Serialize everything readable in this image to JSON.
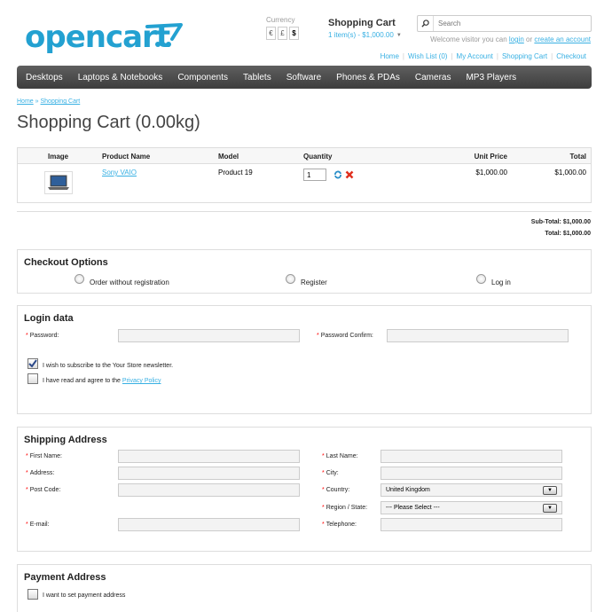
{
  "header": {
    "logo_text": "opencart",
    "currency_label": "Currency",
    "currencies": [
      "€",
      "£",
      "$"
    ],
    "cart_title": "Shopping Cart",
    "cart_summary": "1 item(s) - $1,000.00",
    "search_placeholder": "Search",
    "welcome_prefix": "Welcome visitor you can",
    "welcome_login": "login",
    "welcome_or": "or",
    "welcome_create": "create an account",
    "top_links": [
      "Home",
      "Wish List (0)",
      "My Account",
      "Shopping Cart",
      "Checkout"
    ]
  },
  "menu": [
    "Desktops",
    "Laptops & Notebooks",
    "Components",
    "Tablets",
    "Software",
    "Phones & PDAs",
    "Cameras",
    "MP3 Players"
  ],
  "breadcrumb": {
    "home": "Home",
    "sep": "»",
    "current": "Shopping Cart"
  },
  "page_title": "Shopping Cart  (0.00kg)",
  "cart_table": {
    "headers": {
      "image": "Image",
      "name": "Product Name",
      "model": "Model",
      "quantity": "Quantity",
      "unit_price": "Unit Price",
      "total": "Total"
    },
    "row": {
      "name": "Sony VAIO",
      "model": "Product 19",
      "quantity": "1",
      "unit_price": "$1,000.00",
      "total": "$1,000.00"
    }
  },
  "totals": {
    "subtotal_label": "Sub-Total:",
    "subtotal_value": "$1,000.00",
    "total_label": "Total:",
    "total_value": "$1,000.00"
  },
  "checkout_options": {
    "title": "Checkout Options",
    "options": [
      "Order without registration",
      "Register",
      "Log in"
    ]
  },
  "login_data": {
    "title": "Login data",
    "password_label": "Password:",
    "password_confirm_label": "Password Confirm:",
    "newsletter_label": "I wish to subscribe to the Your Store newsletter.",
    "privacy_prefix": "I have read and agree to the",
    "privacy_link": "Privacy Policy"
  },
  "shipping": {
    "title": "Shipping Address",
    "first_name": "First Name:",
    "last_name": "Last Name:",
    "address": "Address:",
    "city": "City:",
    "post_code": "Post Code:",
    "country": "Country:",
    "country_value": "United Kingdom",
    "region": "Region / State:",
    "region_value": " --- Please Select --- ",
    "email": "E-mail:",
    "telephone": "Telephone:"
  },
  "payment": {
    "title": "Payment Address",
    "set_label": "I want to set payment address"
  },
  "colors": {
    "accent": "#38b0e3",
    "logo": "#23a1d1",
    "required": "#ff0000",
    "menu_bg": "#4a4a4a"
  }
}
